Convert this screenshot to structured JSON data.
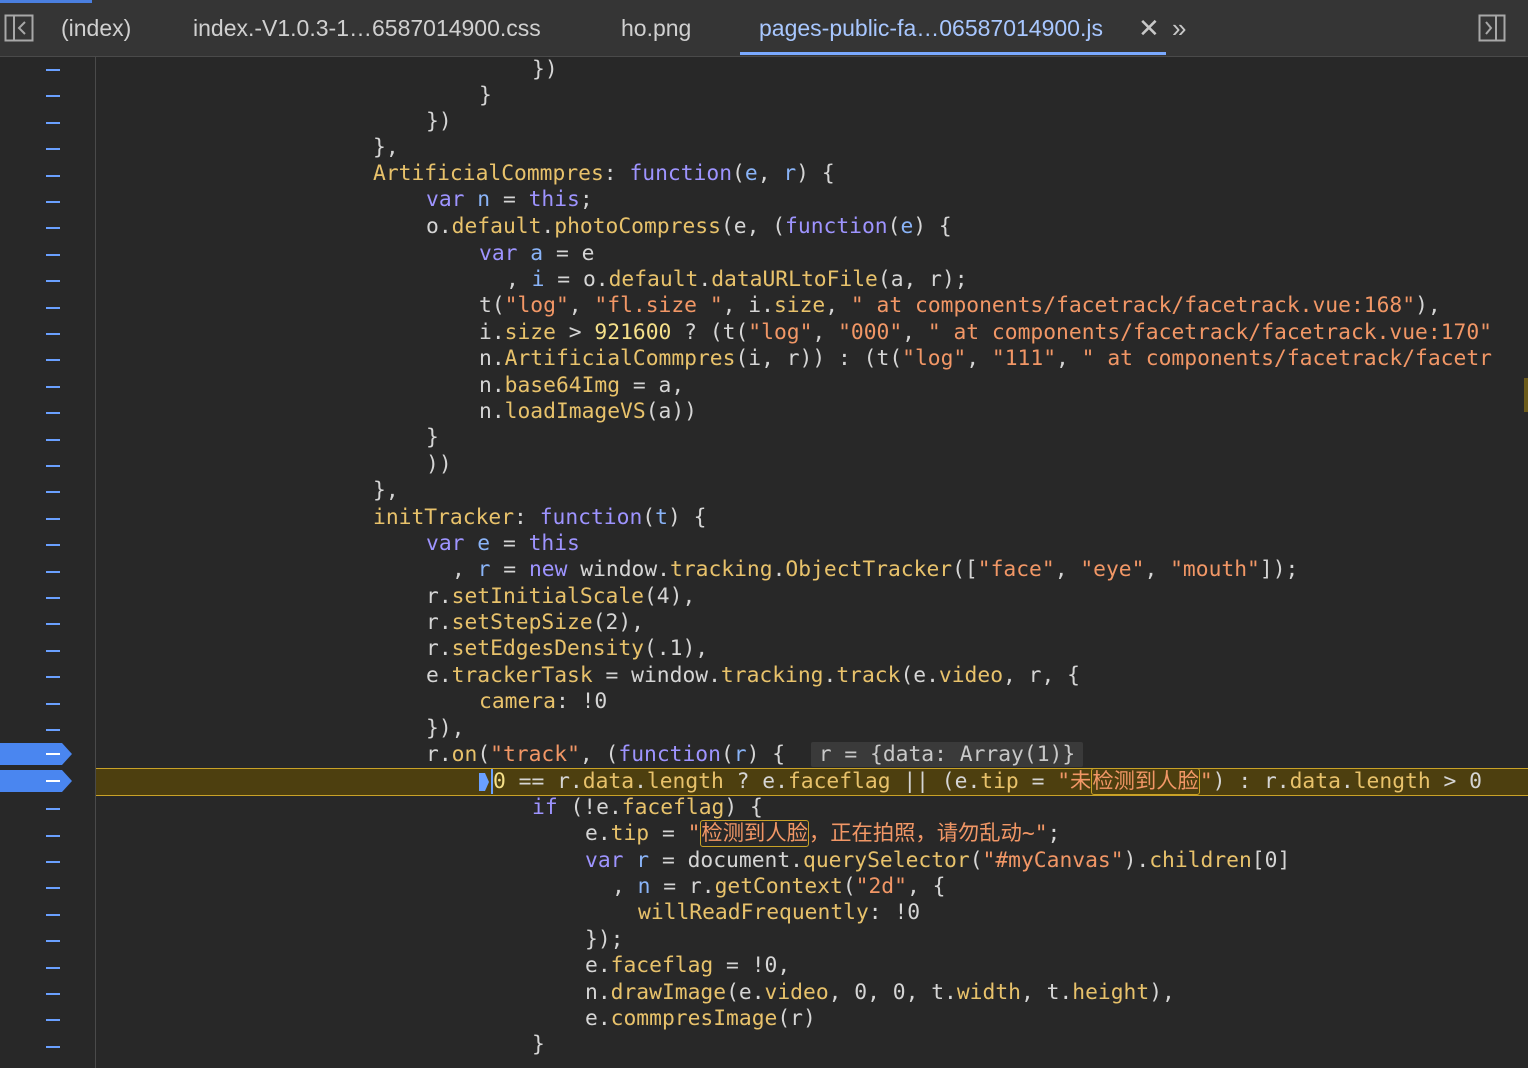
{
  "tabs": {
    "items": [
      {
        "label": "(index)"
      },
      {
        "label": "index.-V1.0.3-1…6587014900.css"
      },
      {
        "label": "ho.png"
      },
      {
        "label": "pages-public-fa…06587014900.js"
      }
    ],
    "close_glyph": "✕",
    "more_glyph": "»"
  },
  "icons": {
    "toggle_navigator": "sidebar-left-icon",
    "toggle_debugger": "sidebar-right-icon"
  },
  "colors": {
    "keyword": "#9e94ff",
    "property": "#e8c26b",
    "string": "#f29766",
    "paused_line_bg": "#4d3f0f",
    "breakpoint": "#4a86f0"
  },
  "gutter": {
    "mark": "–"
  },
  "code": {
    "l1": "})",
    "l2": "}",
    "l3": "})",
    "l4": "},",
    "l5": {
      "a": "ArtificialCommpres",
      "b": ": ",
      "c": "function",
      "d": "(",
      "e": "e",
      "f": ", ",
      "g": "r",
      "h": ") {"
    },
    "l6": {
      "a": "var",
      "b": " ",
      "c": "n",
      "d": " = ",
      "e": "this",
      "f": ";"
    },
    "l7": {
      "a": "o",
      "b": ".",
      "c": "default",
      "d": ".",
      "e": "photoCompress",
      "f": "(e, (",
      "g": "function",
      "h": "(",
      "i": "e",
      "j": ") {"
    },
    "l8": {
      "a": "var",
      "b": " ",
      "c": "a",
      "d": " = e"
    },
    "l9": {
      "a": ", ",
      "b": "i",
      "c": " = o.",
      "d": "default",
      "e": ".",
      "f": "dataURLtoFile",
      "g": "(a, r);"
    },
    "l10": {
      "a": "t(",
      "b": "\"log\"",
      "c": ", ",
      "d": "\"fl.size \"",
      "e": ", i.",
      "f": "size",
      "g": ", ",
      "h": "\" at components/facetrack/facetrack.vue:168\"",
      "i": "),"
    },
    "l11": {
      "a": "i.",
      "b": "size",
      "c": " > ",
      "d": "921600",
      "e": " ? (t(",
      "f": "\"log\"",
      "g": ", ",
      "h": "\"000\"",
      "i": ", ",
      "j": "\" at components/facetrack/facetrack.vue:170\""
    },
    "l12": {
      "a": "n.",
      "b": "ArtificialCommpres",
      "c": "(i, r)) : (t(",
      "d": "\"log\"",
      "e": ", ",
      "f": "\"111\"",
      "g": ", ",
      "h": "\" at components/facetrack/facetr"
    },
    "l13": {
      "a": "n.",
      "b": "base64Img",
      "c": " = a,"
    },
    "l14": {
      "a": "n.",
      "b": "loadImageVS",
      "c": "(a))"
    },
    "l15": "}",
    "l16": "))",
    "l17": "},",
    "l18": {
      "a": "initTracker",
      "b": ": ",
      "c": "function",
      "d": "(",
      "e": "t",
      "f": ") {"
    },
    "l19": {
      "a": "var",
      "b": " ",
      "c": "e",
      "d": " = ",
      "e": "this"
    },
    "l20": {
      "a": ", ",
      "b": "r",
      "c": " = ",
      "d": "new",
      "e": " window.",
      "f": "tracking",
      "g": ".",
      "h": "ObjectTracker",
      "i": "([",
      "j": "\"face\"",
      "k": ", ",
      "l": "\"eye\"",
      "m": ", ",
      "n": "\"mouth\"",
      "o": "]);"
    },
    "l21": {
      "a": "r.",
      "b": "setInitialScale",
      "c": "(4),"
    },
    "l22": {
      "a": "r.",
      "b": "setStepSize",
      "c": "(2),"
    },
    "l23": {
      "a": "r.",
      "b": "setEdgesDensity",
      "c": "(.1),"
    },
    "l24": {
      "a": "e.",
      "b": "trackerTask",
      "c": " = window.",
      "d": "tracking",
      "e": ".",
      "f": "track",
      "g": "(e.",
      "h": "video",
      "i": ", r, {"
    },
    "l25": {
      "a": "camera",
      "b": ": !0"
    },
    "l26": "}),",
    "l27": {
      "a": "r.",
      "b": "on",
      "c": "(",
      "d": "\"track\"",
      "e": ", (",
      "f": "function",
      "g": "(",
      "h": "r",
      "i": ") {",
      "j": "r = {data: Array(1)}"
    },
    "l28": {
      "a": "0",
      "b": " == r.",
      "c": "data",
      "d": ".",
      "e": "length",
      "f": " ? e.",
      "g": "faceflag",
      "h": " || (e.",
      "i": "tip",
      "j": " = ",
      "k": "\"未",
      "l": "检测到人脸",
      "m": "\"",
      "n": ") : r.",
      "o": "data",
      "p": ".",
      "q": "length",
      "r": " > 0"
    },
    "l29": {
      "a": "if",
      "b": " (!e.",
      "c": "faceflag",
      "d": ") {"
    },
    "l30": {
      "a": "e.",
      "b": "tip",
      "c": " = ",
      "d": "\"",
      "e": "检测到人脸",
      "f": "，正在拍照，请勿乱动~\"",
      "g": ";"
    },
    "l31": {
      "a": "var",
      "b": " ",
      "c": "r",
      "d": " = document.",
      "e": "querySelector",
      "f": "(",
      "g": "\"#myCanvas\"",
      "h": ").",
      "i": "children",
      "j": "[0]"
    },
    "l32": {
      "a": ", ",
      "b": "n",
      "c": " = r.",
      "d": "getContext",
      "e": "(",
      "f": "\"2d\"",
      "g": ", {"
    },
    "l33": {
      "a": "willReadFrequently",
      "b": ": !0"
    },
    "l34": "});",
    "l35": {
      "a": "e.",
      "b": "faceflag",
      "c": " = !0,"
    },
    "l36": {
      "a": "n.",
      "b": "drawImage",
      "c": "(e.",
      "d": "video",
      "e": ", 0, 0, t.",
      "f": "width",
      "g": ", t.",
      "h": "height",
      "i": "),"
    },
    "l37": {
      "a": "e.",
      "b": "commpresImage",
      "c": "(r)"
    },
    "l38": "}"
  }
}
